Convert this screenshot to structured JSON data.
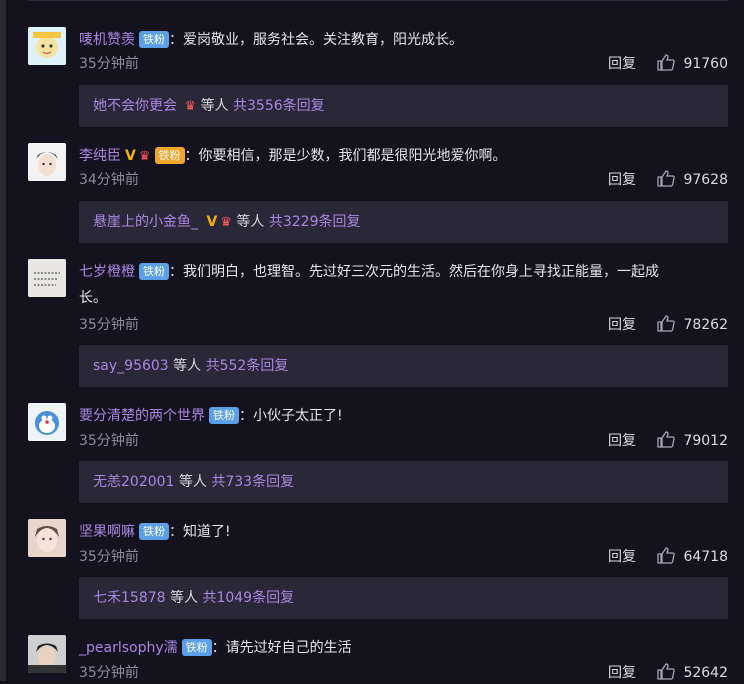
{
  "common": {
    "reply_label": "回复",
    "middle": "等人"
  },
  "comments": [
    {
      "username": "唛机赞羡",
      "badge": "铁粉",
      "text": "爱岗敬业，服务社会。关注教育，阳光成长。",
      "time": "35分钟前",
      "likes": "91760",
      "reply_user": "她不会你更会",
      "reply_count": "共3556条回复"
    },
    {
      "username": "李纯臣",
      "badge": "铁粉",
      "text": "你要相信，那是少数，我们都是很阳光地爱你啊。",
      "time": "34分钟前",
      "likes": "97628",
      "reply_user": "悬崖上的小金鱼_",
      "reply_count": "共3229条回复"
    },
    {
      "username": "七岁橙橙",
      "badge": "铁粉",
      "text": "我们明白，也理智。先过好三次元的生活。然后在你身上寻找正能量，一起成",
      "text2": "长。",
      "time": "35分钟前",
      "likes": "78262",
      "reply_user": "say_95603",
      "reply_count": "共552条回复"
    },
    {
      "username": "要分清楚的两个世界",
      "badge": "铁粉",
      "text": "小伙子太正了!",
      "time": "35分钟前",
      "likes": "79012",
      "reply_user": "无恙202001",
      "reply_count": "共733条回复"
    },
    {
      "username": "坚果啊嘛",
      "badge": "铁粉",
      "text": "知道了!",
      "time": "35分钟前",
      "likes": "64718",
      "reply_user": "七禾15878",
      "reply_count": "共1049条回复"
    },
    {
      "username": "_pearlsophy濡",
      "badge": "铁粉",
      "text": "请先过好自己的生活",
      "time": "35分钟前",
      "likes": "52642"
    }
  ],
  "icons": {
    "like": "thumbs-up-icon",
    "vip": "vip-v-icon",
    "crown": "crown-icon"
  },
  "colors": {
    "background": "#151220",
    "username": "#a887e0",
    "badge": "#5a9fe8",
    "replies_box": "#2a2738",
    "vip": "#f5b300"
  }
}
